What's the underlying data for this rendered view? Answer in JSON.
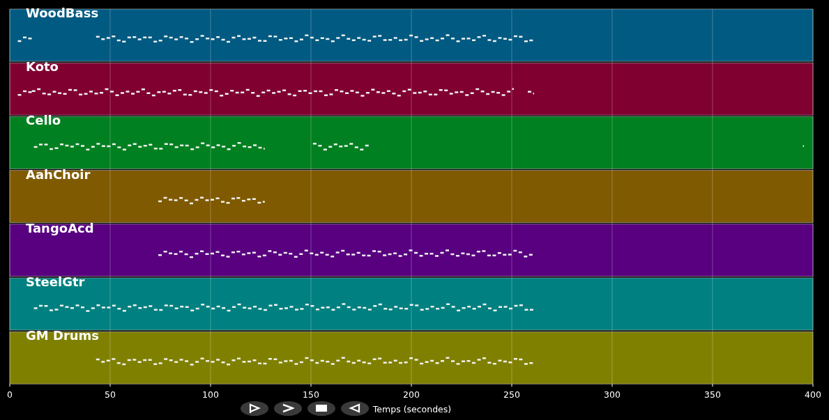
{
  "tracks": [
    {
      "name": "WoodBass",
      "color": "#005a82"
    },
    {
      "name": "Koto",
      "color": "#800030"
    },
    {
      "name": "Cello",
      "color": "#008020"
    },
    {
      "name": "AahChoir",
      "color": "#805a00"
    },
    {
      "name": "TangoAcd",
      "color": "#580080"
    },
    {
      "name": "SteelGtr",
      "color": "#008080"
    },
    {
      "name": "GM Drums",
      "color": "#808000"
    }
  ],
  "axis": {
    "ticks": [
      "0",
      "50",
      "100",
      "150",
      "200",
      "250",
      "300",
      "350",
      "400"
    ],
    "label": "Temps (secondes)"
  },
  "toolbar": [
    {
      "kind": "play"
    },
    {
      "kind": "next"
    },
    {
      "kind": "stop"
    },
    {
      "kind": "back"
    }
  ]
}
